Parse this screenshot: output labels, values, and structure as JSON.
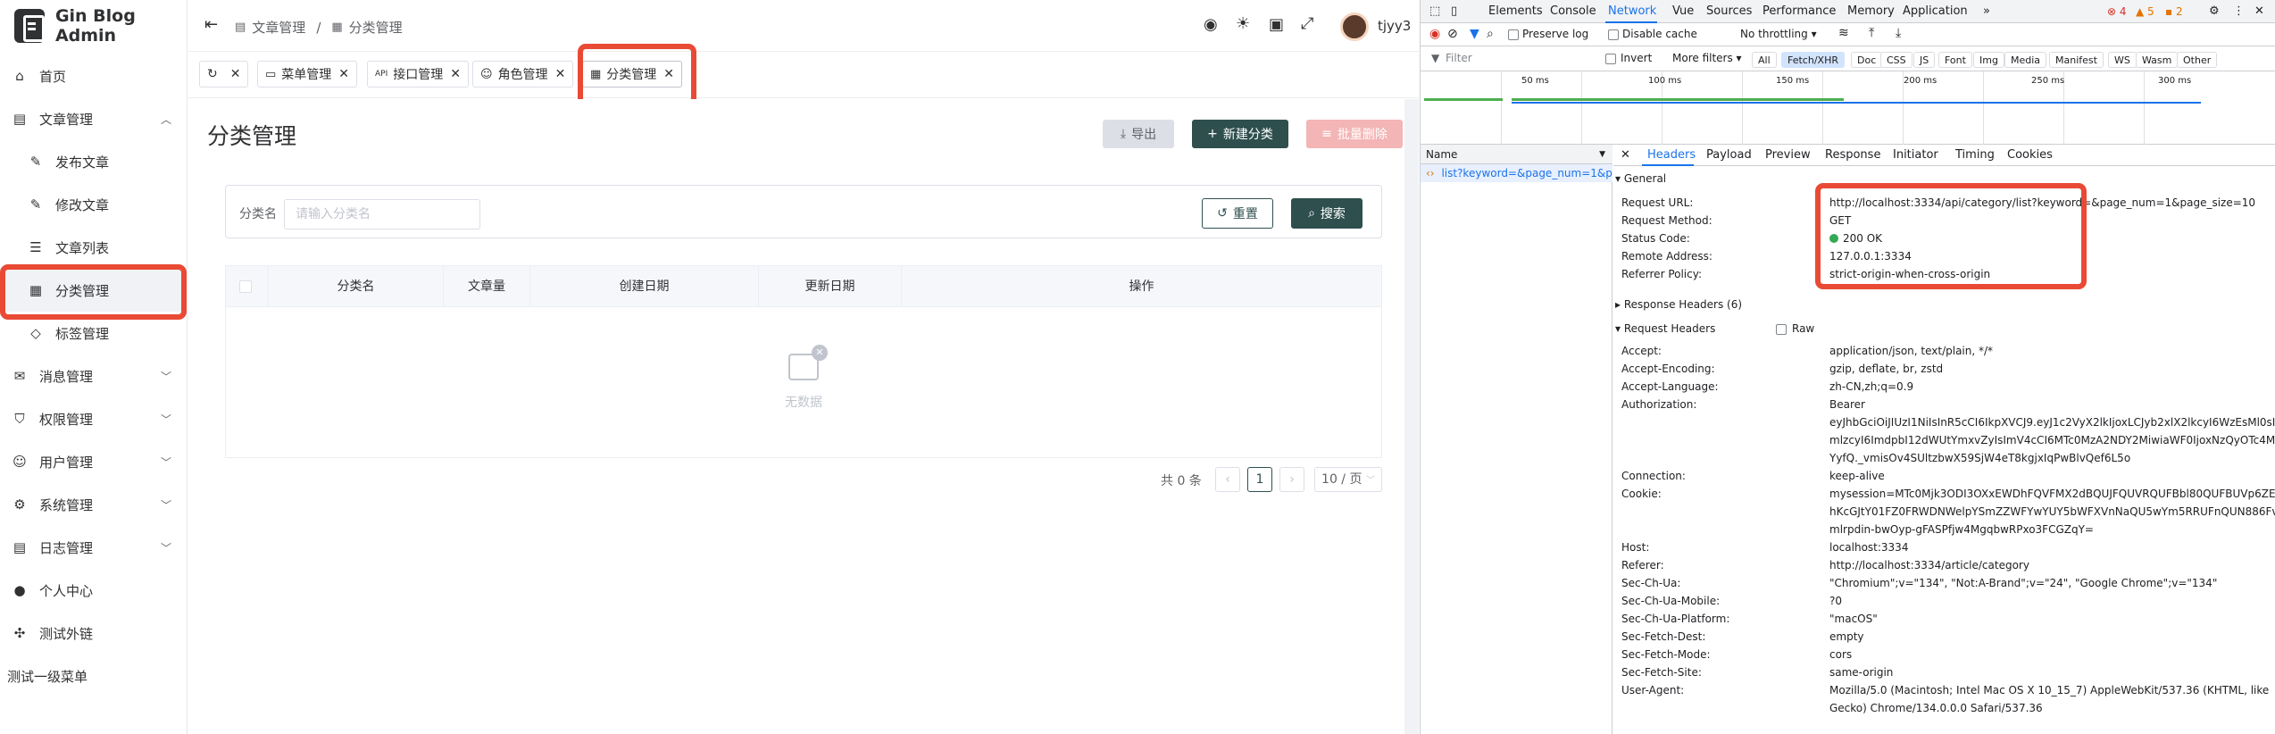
{
  "app": {
    "title": "Gin Blog Admin"
  },
  "sidebar": {
    "items": [
      {
        "label": "首页"
      },
      {
        "label": "文章管理"
      },
      {
        "label": "发布文章"
      },
      {
        "label": "修改文章"
      },
      {
        "label": "文章列表"
      },
      {
        "label": "分类管理"
      },
      {
        "label": "标签管理"
      },
      {
        "label": "消息管理"
      },
      {
        "label": "权限管理"
      },
      {
        "label": "用户管理"
      },
      {
        "label": "系统管理"
      },
      {
        "label": "日志管理"
      },
      {
        "label": "个人中心"
      },
      {
        "label": "测试外链"
      },
      {
        "label": "测试一级菜单"
      }
    ]
  },
  "header": {
    "breadcrumb": [
      "文章管理",
      "/",
      "分类管理"
    ],
    "username": "tjyy3"
  },
  "tags": [
    {
      "label": "菜单管理"
    },
    {
      "label": "接口管理"
    },
    {
      "label": "角色管理"
    },
    {
      "label": "分类管理"
    }
  ],
  "main": {
    "page_title": "分类管理",
    "export_label": "导出",
    "new_label": "新建分类",
    "batch_delete_label": "批量删除",
    "search_label": "分类名",
    "search_placeholder": "请输入分类名",
    "reset_label": "重置",
    "search_button": "搜索",
    "columns": [
      "分类名",
      "文章量",
      "创建日期",
      "更新日期",
      "操作"
    ],
    "empty_text": "无数据",
    "total_text": "共 0 条",
    "current_page": "1",
    "page_size": "10 / 页"
  },
  "devtools": {
    "tabs": [
      "Elements",
      "Console",
      "Network",
      "Vue",
      "Sources",
      "Performance",
      "Memory",
      "Application"
    ],
    "active_tab": "Network",
    "errors": "4",
    "warnings": "5",
    "issues": "2",
    "preserve_log": "Preserve log",
    "disable_cache": "Disable cache",
    "throttling": "No throttling",
    "filter_placeholder": "Filter",
    "invert": "Invert",
    "more_filters": "More filters",
    "filter_chips": [
      "All",
      "Fetch/XHR",
      "Doc",
      "CSS",
      "JS",
      "Font",
      "Img",
      "Media",
      "Manifest",
      "WS",
      "Wasm",
      "Other"
    ],
    "timeline_labels": [
      "50 ms",
      "100 ms",
      "150 ms",
      "200 ms",
      "250 ms",
      "300 ms"
    ],
    "name_header": "Name",
    "request_name": "list?keyword=&page_num=1&p...",
    "detail_tabs": [
      "Headers",
      "Payload",
      "Preview",
      "Response",
      "Initiator",
      "Timing",
      "Cookies"
    ],
    "general_title": "General",
    "general": [
      {
        "k": "Request URL:",
        "v": "http://localhost:3334/api/category/list?keyword=&page_num=1&page_size=10"
      },
      {
        "k": "Request Method:",
        "v": "GET"
      },
      {
        "k": "Status Code:",
        "v": "200 OK"
      },
      {
        "k": "Remote Address:",
        "v": "127.0.0.1:3334"
      },
      {
        "k": "Referrer Policy:",
        "v": "strict-origin-when-cross-origin"
      }
    ],
    "response_headers_title": "Response Headers (6)",
    "request_headers_title": "Request Headers",
    "raw_label": "Raw",
    "request_headers": [
      {
        "k": "Accept:",
        "v": "application/json, text/plain, */*"
      },
      {
        "k": "Accept-Encoding:",
        "v": "gzip, deflate, br, zstd"
      },
      {
        "k": "Accept-Language:",
        "v": "zh-CN,zh;q=0.9"
      },
      {
        "k": "Authorization:",
        "v": "Bearer"
      },
      {
        "k": "",
        "v": "eyJhbGciOiJIUzI1NiIsInR5cCI6IkpXVCJ9.eyJ1c2VyX2lkIjoxLCJyb2xlX2lkcyI6WzEsMl0sI"
      },
      {
        "k": "",
        "v": "mlzcyI6ImdpbI12dWUtYmxvZyIsImV4cCI6MTc0MzA2NDY2MiwiaWF0IjoxNzQyOTc4Mj"
      },
      {
        "k": "",
        "v": "YyfQ._vmisOv4SUltzbwX59SjW4eT8kgjxIqPwBlvQef6L5o"
      },
      {
        "k": "Connection:",
        "v": "keep-alive"
      },
      {
        "k": "Cookie:",
        "v": "mysession=MTc0Mjk3ODI3OXxEWDhFQVFMX2dBQUJFQUVRQUFBbl80QUFBUVp6ZE"
      },
      {
        "k": "",
        "v": "hKcGJtY01FZ0FRWDNWelpYSmZZWFYwYUY5bWFXVnNaQU5wYm5RRUFnQUN886Fv"
      },
      {
        "k": "",
        "v": "mlrpdin-bwOyp-gFASPfjw4MgqbwRPxo3FCGZqY="
      },
      {
        "k": "Host:",
        "v": "localhost:3334"
      },
      {
        "k": "Referer:",
        "v": "http://localhost:3334/article/category"
      },
      {
        "k": "Sec-Ch-Ua:",
        "v": "\"Chromium\";v=\"134\", \"Not:A-Brand\";v=\"24\", \"Google Chrome\";v=\"134\""
      },
      {
        "k": "Sec-Ch-Ua-Mobile:",
        "v": "?0"
      },
      {
        "k": "Sec-Ch-Ua-Platform:",
        "v": "\"macOS\""
      },
      {
        "k": "Sec-Fetch-Dest:",
        "v": "empty"
      },
      {
        "k": "Sec-Fetch-Mode:",
        "v": "cors"
      },
      {
        "k": "Sec-Fetch-Site:",
        "v": "same-origin"
      },
      {
        "k": "User-Agent:",
        "v": "Mozilla/5.0 (Macintosh; Intel Mac OS X 10_15_7) AppleWebKit/537.36 (KHTML, like"
      },
      {
        "k": "",
        "v": "Gecko) Chrome/134.0.0.0 Safari/537.36"
      }
    ]
  },
  "colors": {
    "highlight": "#e94a35",
    "primary": "#2f4f4f",
    "devtools_accent": "#1a73e8"
  }
}
